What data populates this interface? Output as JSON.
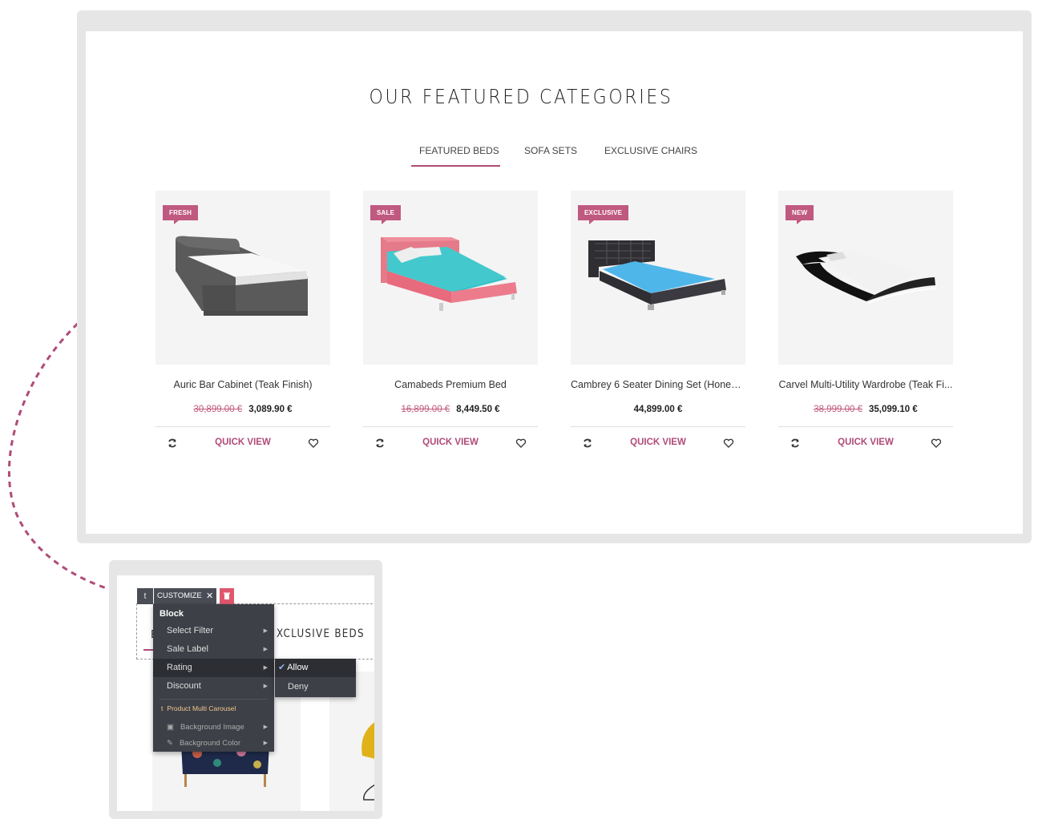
{
  "section": {
    "title": "OUR FEATURED CATEGORIES",
    "tabs": [
      {
        "label": "FEATURED BEDS",
        "active": true
      },
      {
        "label": "SOFA SETS",
        "active": false
      },
      {
        "label": "EXCLUSIVE CHAIRS",
        "active": false
      }
    ]
  },
  "products": [
    {
      "badge": "FRESH",
      "name": "Auric Bar Cabinet (Teak Finish)",
      "old_price": "30,899.00 €",
      "price": "3,089.90 €",
      "quick_view": "QUICK VIEW"
    },
    {
      "badge": "SALE",
      "name": "Camabeds Premium Bed",
      "old_price": "16,899.00 €",
      "price": "8,449.50 €",
      "quick_view": "QUICK VIEW"
    },
    {
      "badge": "EXCLUSIVE",
      "name": "Cambrey 6 Seater Dining Set (Honey ...",
      "old_price": "",
      "price": "44,899.00 €",
      "quick_view": "QUICK VIEW"
    },
    {
      "badge": "NEW",
      "name": "Carvel Multi-Utility Wardrobe (Teak Fi...",
      "old_price": "38,999.00 €",
      "price": "35,099.10 €",
      "quick_view": "QUICK VIEW"
    }
  ],
  "editor": {
    "customize_label": "CUSTOMIZE",
    "background_heading_letter": "E",
    "background_heading": "XCLUSIVE BEDS",
    "menu": {
      "heading": "Block",
      "items": [
        "Select Filter",
        "Sale Label",
        "Rating",
        "Discount"
      ],
      "group_label": "Product Multi Carousel",
      "group_items": [
        "Background Image",
        "Background Color"
      ]
    },
    "submenu": [
      "Allow",
      "Deny"
    ]
  },
  "colors": {
    "accent": "#b04b79",
    "badge": "#c0597f",
    "menu_bg": "#3d4047"
  }
}
